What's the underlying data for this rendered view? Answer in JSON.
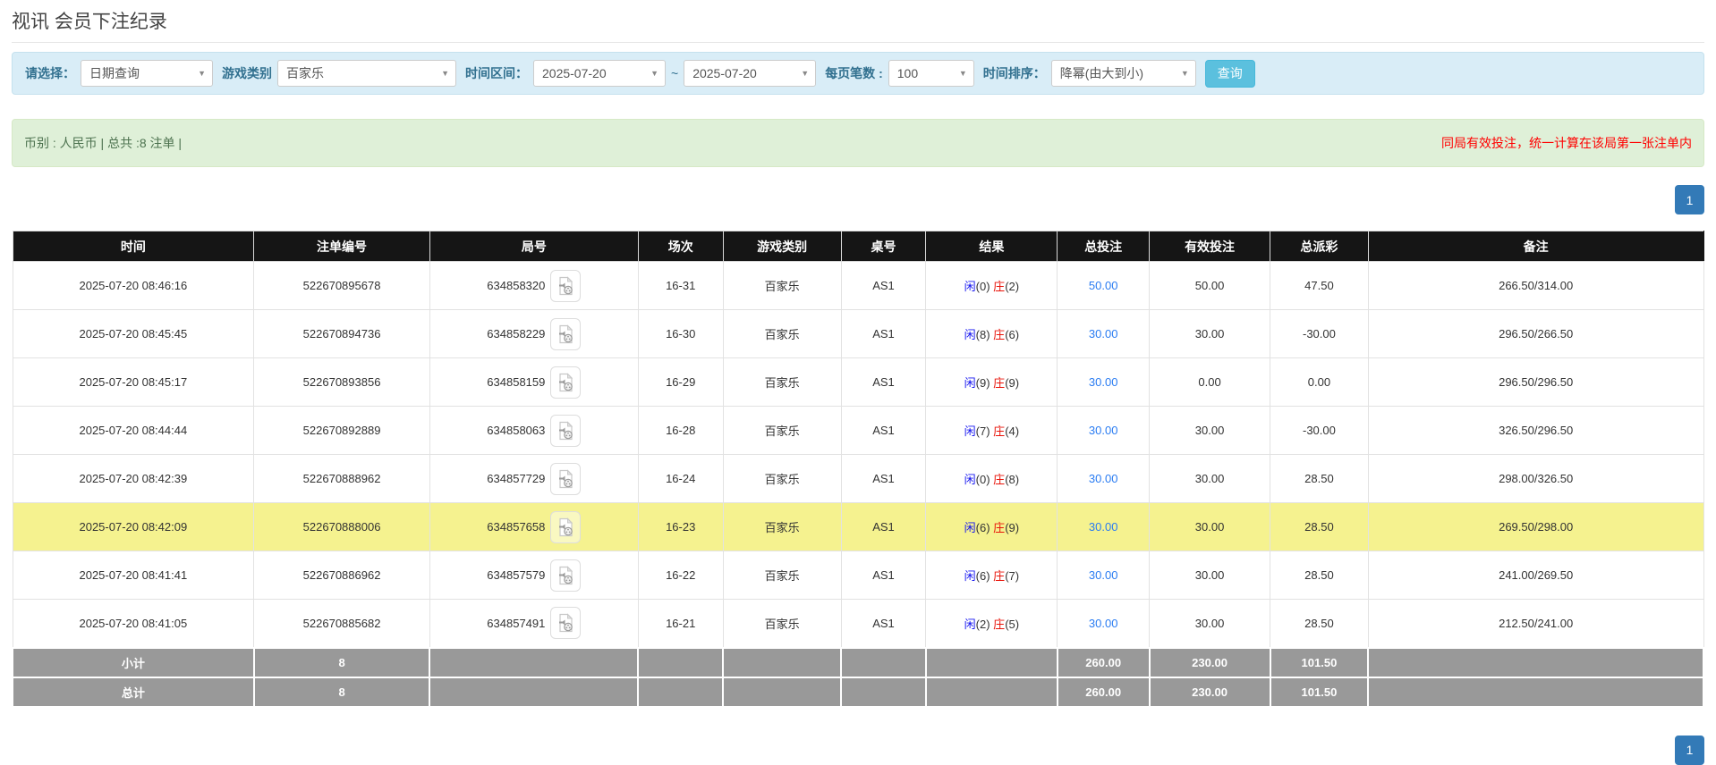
{
  "page": {
    "title": "视讯 会员下注纪录"
  },
  "filters": {
    "select_label": "请选择：",
    "select_value": "日期查询",
    "game_type_label": "游戏类别",
    "game_type_value": "百家乐",
    "time_range_label": "时间区间：",
    "date_from": "2025-07-20",
    "date_separator": "~",
    "date_to": "2025-07-20",
    "page_size_label": "每页笔数 :",
    "page_size_value": "100",
    "sort_label": "时间排序：",
    "sort_value": "降幂(由大到小)",
    "search_button_label": "查询"
  },
  "summary": {
    "left_text": "币别 : 人民币 | 总共 :8 注单 |",
    "right_notice": "同局有效投注，统一计算在该局第一张注单内"
  },
  "pagination": {
    "current_page": "1"
  },
  "table": {
    "headers": [
      "时间",
      "注单编号",
      "局号",
      "场次",
      "游戏类别",
      "桌号",
      "结果",
      "总投注",
      "有效投注",
      "总派彩",
      "备注"
    ],
    "rows": [
      {
        "time": "2025-07-20 08:46:16",
        "bet_no": "522670895678",
        "round_no": "634858320",
        "session": "16-31",
        "game": "百家乐",
        "table_no": "AS1",
        "result": {
          "player_label": "闲",
          "player_score": "(0)",
          "banker_label": "庄",
          "banker_score": "(2)"
        },
        "total_bet": "50.00",
        "valid_bet": "50.00",
        "payout": "47.50",
        "remark": "266.50/314.00",
        "highlighted": false
      },
      {
        "time": "2025-07-20 08:45:45",
        "bet_no": "522670894736",
        "round_no": "634858229",
        "session": "16-30",
        "game": "百家乐",
        "table_no": "AS1",
        "result": {
          "player_label": "闲",
          "player_score": "(8)",
          "banker_label": "庄",
          "banker_score": "(6)"
        },
        "total_bet": "30.00",
        "valid_bet": "30.00",
        "payout": "-30.00",
        "remark": "296.50/266.50",
        "highlighted": false
      },
      {
        "time": "2025-07-20 08:45:17",
        "bet_no": "522670893856",
        "round_no": "634858159",
        "session": "16-29",
        "game": "百家乐",
        "table_no": "AS1",
        "result": {
          "player_label": "闲",
          "player_score": "(9)",
          "banker_label": "庄",
          "banker_score": "(9)"
        },
        "total_bet": "30.00",
        "valid_bet": "0.00",
        "payout": "0.00",
        "remark": "296.50/296.50",
        "highlighted": false
      },
      {
        "time": "2025-07-20 08:44:44",
        "bet_no": "522670892889",
        "round_no": "634858063",
        "session": "16-28",
        "game": "百家乐",
        "table_no": "AS1",
        "result": {
          "player_label": "闲",
          "player_score": "(7)",
          "banker_label": "庄",
          "banker_score": "(4)"
        },
        "total_bet": "30.00",
        "valid_bet": "30.00",
        "payout": "-30.00",
        "remark": "326.50/296.50",
        "highlighted": false
      },
      {
        "time": "2025-07-20 08:42:39",
        "bet_no": "522670888962",
        "round_no": "634857729",
        "session": "16-24",
        "game": "百家乐",
        "table_no": "AS1",
        "result": {
          "player_label": "闲",
          "player_score": "(0)",
          "banker_label": "庄",
          "banker_score": "(8)"
        },
        "total_bet": "30.00",
        "valid_bet": "30.00",
        "payout": "28.50",
        "remark": "298.00/326.50",
        "highlighted": false
      },
      {
        "time": "2025-07-20 08:42:09",
        "bet_no": "522670888006",
        "round_no": "634857658",
        "session": "16-23",
        "game": "百家乐",
        "table_no": "AS1",
        "result": {
          "player_label": "闲",
          "player_score": "(6)",
          "banker_label": "庄",
          "banker_score": "(9)"
        },
        "total_bet": "30.00",
        "valid_bet": "30.00",
        "payout": "28.50",
        "remark": "269.50/298.00",
        "highlighted": true
      },
      {
        "time": "2025-07-20 08:41:41",
        "bet_no": "522670886962",
        "round_no": "634857579",
        "session": "16-22",
        "game": "百家乐",
        "table_no": "AS1",
        "result": {
          "player_label": "闲",
          "player_score": "(6)",
          "banker_label": "庄",
          "banker_score": "(7)"
        },
        "total_bet": "30.00",
        "valid_bet": "30.00",
        "payout": "28.50",
        "remark": "241.00/269.50",
        "highlighted": false
      },
      {
        "time": "2025-07-20 08:41:05",
        "bet_no": "522670885682",
        "round_no": "634857491",
        "session": "16-21",
        "game": "百家乐",
        "table_no": "AS1",
        "result": {
          "player_label": "闲",
          "player_score": "(2)",
          "banker_label": "庄",
          "banker_score": "(5)"
        },
        "total_bet": "30.00",
        "valid_bet": "30.00",
        "payout": "28.50",
        "remark": "212.50/241.00",
        "highlighted": false
      }
    ],
    "footer_rows": [
      {
        "label": "小计",
        "count": "8",
        "total_bet": "260.00",
        "valid_bet": "230.00",
        "payout": "101.50"
      },
      {
        "label": "总计",
        "count": "8",
        "total_bet": "260.00",
        "valid_bet": "230.00",
        "payout": "101.50"
      }
    ]
  },
  "icons": {
    "video_replay": "video-file-icon",
    "dropdown_caret": "chevron-down-icon"
  },
  "colors": {
    "filter_bg": "#d9edf7",
    "filter_border": "#c5e1ee",
    "filter_label": "#31708f",
    "btn_info": "#5bc0de",
    "btn_info_border": "#46b8da",
    "summary_bg": "#dff0d8",
    "summary_border": "#d6e9c6",
    "summary_text": "#4e7350",
    "notice_red": "#ff0000",
    "pagination_blue": "#337ab7",
    "header_bg": "#151515",
    "footer_bg": "#999999",
    "highlight_yellow": "#f5f28f",
    "link_blue": "#2a7cf2",
    "player_blue": "#1414f0",
    "banker_red": "#e81309",
    "negative_red": "#ff0000"
  }
}
